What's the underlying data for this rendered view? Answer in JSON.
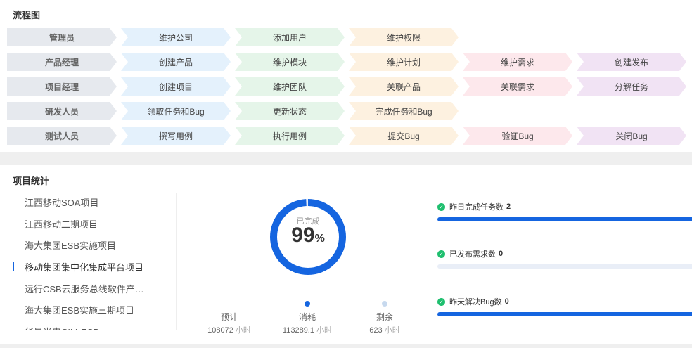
{
  "flowchart": {
    "title": "流程图",
    "rows": [
      {
        "role": "管理员",
        "steps": [
          "维护公司",
          "添加用户",
          "维护权限"
        ]
      },
      {
        "role": "产品经理",
        "steps": [
          "创建产品",
          "维护模块",
          "维护计划",
          "维护需求",
          "创建发布"
        ]
      },
      {
        "role": "项目经理",
        "steps": [
          "创建项目",
          "维护团队",
          "关联产品",
          "关联需求",
          "分解任务"
        ]
      },
      {
        "role": "研发人员",
        "steps": [
          "领取任务和Bug",
          "更新状态",
          "完成任务和Bug"
        ]
      },
      {
        "role": "测试人员",
        "steps": [
          "撰写用例",
          "执行用例",
          "提交Bug",
          "验证Bug",
          "关闭Bug"
        ]
      }
    ]
  },
  "stats": {
    "title": "项目统计",
    "projects": [
      "江西移动SOA项目",
      "江西移动二期项目",
      "海大集团ESB实施项目",
      "移动集团集中化集成平台项目",
      "远行CSB云服务总线软件产…",
      "海大集团ESB实施三期项目",
      "华星光电CIM-ESB"
    ],
    "active_index": 3,
    "progress": {
      "label": "已完成",
      "value": "99",
      "unit": "%",
      "percent": 99
    },
    "metrics": [
      {
        "label": "预计",
        "value": "108072",
        "unit": "小时",
        "dot_color": ""
      },
      {
        "label": "消耗",
        "value": "113289.1",
        "unit": "小时",
        "dot_color": "#1565e0"
      },
      {
        "label": "剩余",
        "value": "623",
        "unit": "小时",
        "dot_color": "#c7d9ee"
      }
    ],
    "summary": [
      {
        "label": "昨日完成任务数",
        "value": "2",
        "fill": 1.0
      },
      {
        "label": "已发布需求数",
        "value": "0",
        "fill": 0.0
      },
      {
        "label": "昨天解决Bug数",
        "value": "0",
        "fill": 1.0
      }
    ]
  },
  "colors": {
    "accent": "#1565e0",
    "ring_track": "#e9eef7",
    "check": "#1fbf6f",
    "step_colors": [
      "#e4f1fc",
      "#e5f5e9",
      "#fdf1e0",
      "#fde8ec",
      "#f1e3f4"
    ]
  },
  "icons": {
    "summary_check": "check-circle-icon"
  }
}
